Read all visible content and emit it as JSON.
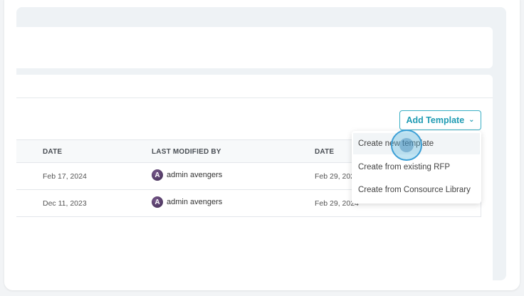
{
  "toolbar": {
    "add_template_label": "Add Template"
  },
  "table": {
    "headers": {
      "date": "DATE",
      "last_modified_by": "LAST MODIFIED BY",
      "date2": "DATE"
    },
    "rows": [
      {
        "date": "Feb 17, 2024",
        "modified_by": "admin avengers",
        "date2": "Feb 29, 2024"
      },
      {
        "date": "Dec 11, 2023",
        "modified_by": "admin avengers",
        "date2": "Feb 29, 2024"
      }
    ]
  },
  "dropdown": {
    "items": [
      {
        "label": "Create new template"
      },
      {
        "label": "Create from existing RFP"
      },
      {
        "label": "Create from Consource Library"
      }
    ]
  },
  "colors": {
    "accent": "#1f9bb3",
    "panel_bg": "#eef2f5"
  },
  "icons": {
    "chevron": "chevron-down-icon",
    "avatar": "avengers-avatar-icon"
  }
}
